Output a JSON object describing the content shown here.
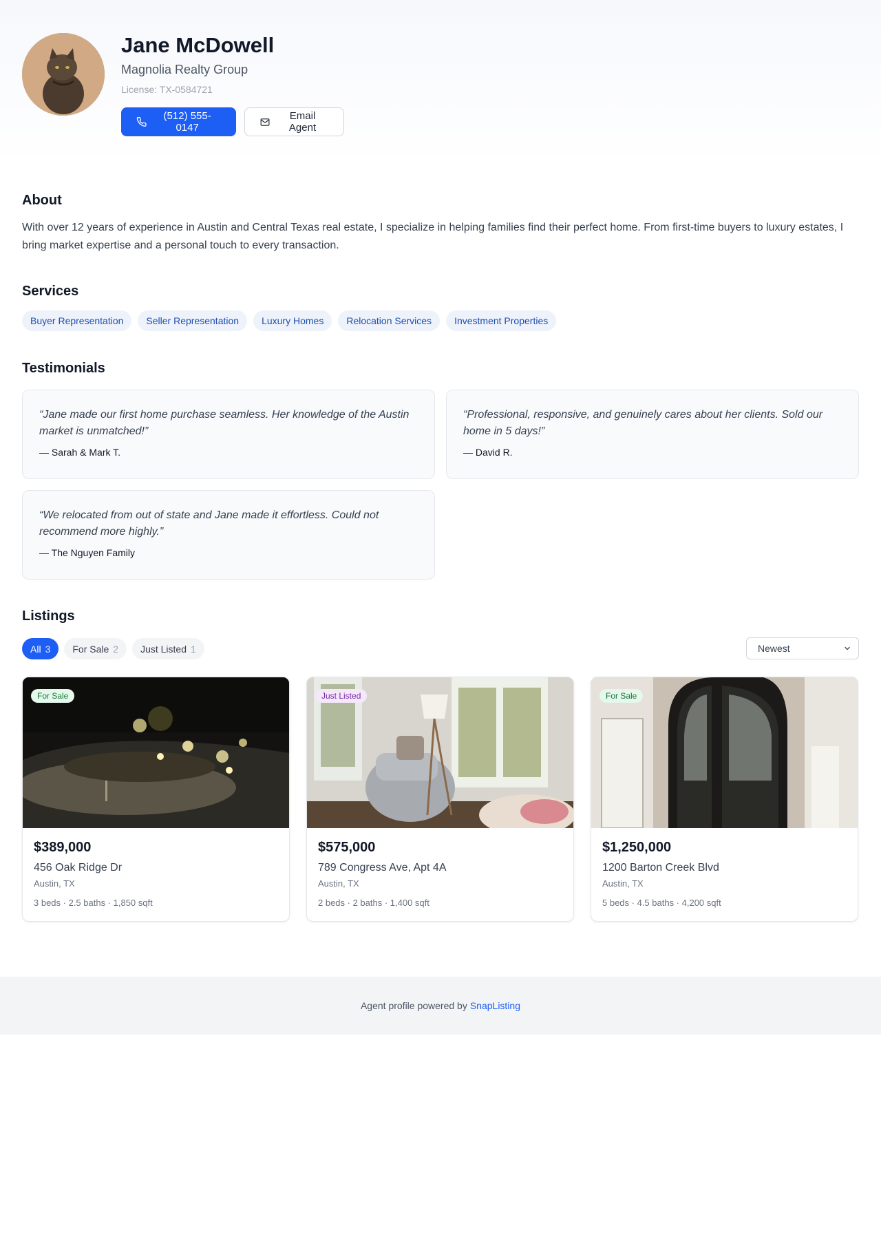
{
  "agent": {
    "name": "Jane McDowell",
    "agency": "Magnolia Realty Group",
    "license": "License: TX-0584721",
    "phone_label": "(512) 555-0147",
    "email_label": "Email Agent"
  },
  "about": {
    "title": "About",
    "text": "With over 12 years of experience in Austin and Central Texas real estate, I specialize in helping families find their perfect home. From first-time buyers to luxury estates, I bring market expertise and a personal touch to every transaction."
  },
  "services": {
    "title": "Services",
    "items": [
      "Buyer Representation",
      "Seller Representation",
      "Luxury Homes",
      "Relocation Services",
      "Investment Properties"
    ]
  },
  "testimonials": {
    "title": "Testimonials",
    "items": [
      {
        "quote": "“Jane made our first home purchase seamless. Her knowledge of the Austin market is unmatched!”",
        "author": "— Sarah & Mark T."
      },
      {
        "quote": "“Professional, responsive, and genuinely cares about her clients. Sold our home in 5 days!”",
        "author": "— David R."
      },
      {
        "quote": "“We relocated from out of state and Jane made it effortless. Could not recommend more highly.”",
        "author": "— The Nguyen Family"
      }
    ]
  },
  "listings": {
    "title": "Listings",
    "filters": [
      {
        "label": "All",
        "count": "3"
      },
      {
        "label": "For Sale",
        "count": "2"
      },
      {
        "label": "Just Listed",
        "count": "1"
      }
    ],
    "sort": {
      "selected": "Newest"
    },
    "items": [
      {
        "badge": "For Sale",
        "price": "$389,000",
        "address": "456 Oak Ridge Dr",
        "city": "Austin, TX",
        "specs": "3 beds · 2.5 baths · 1,850 sqft"
      },
      {
        "badge": "Just Listed",
        "price": "$575,000",
        "address": "789 Congress Ave, Apt 4A",
        "city": "Austin, TX",
        "specs": "2 beds · 2 baths · 1,400 sqft"
      },
      {
        "badge": "For Sale",
        "price": "$1,250,000",
        "address": "1200 Barton Creek Blvd",
        "city": "Austin, TX",
        "specs": "5 beds · 4.5 baths · 4,200 sqft"
      }
    ]
  },
  "footer": {
    "text": "Agent profile powered by",
    "link": "SnapListing"
  },
  "colors": {
    "accent": "#1d5ef5",
    "badge_sale": "#157a3b",
    "badge_new": "#7a2aa8"
  }
}
